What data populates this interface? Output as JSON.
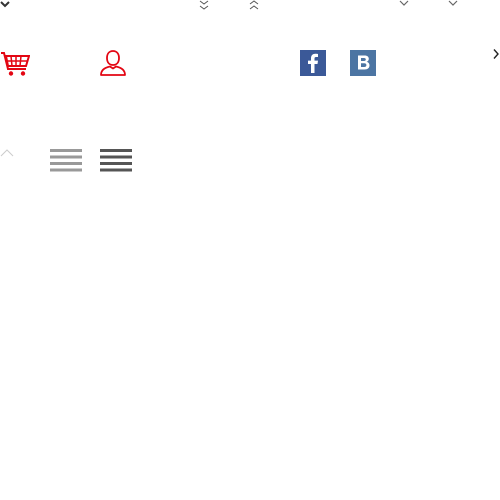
{
  "sprite_sheet": {
    "icons": [
      {
        "name": "caret-down-icon",
        "color": "#333333"
      },
      {
        "name": "double-chevron-down-icon",
        "color": "#555555"
      },
      {
        "name": "double-chevron-up-icon",
        "color": "#555555"
      },
      {
        "name": "chevron-down-icon",
        "color": "#666666"
      },
      {
        "name": "chevron-down-icon",
        "color": "#666666"
      },
      {
        "name": "shopping-cart-icon",
        "color": "#e30613"
      },
      {
        "name": "user-icon",
        "color": "#e30613"
      },
      {
        "name": "facebook-icon",
        "color": "#3b5998",
        "glyph": "f"
      },
      {
        "name": "vk-icon",
        "color": "#4c75a3",
        "glyph": "B"
      },
      {
        "name": "chevron-right-icon",
        "color": "#222222"
      },
      {
        "name": "chevron-up-icon",
        "color": "#cccccc"
      },
      {
        "name": "menu-icon",
        "color": "#999999"
      },
      {
        "name": "menu-icon",
        "color": "#555555"
      }
    ]
  }
}
